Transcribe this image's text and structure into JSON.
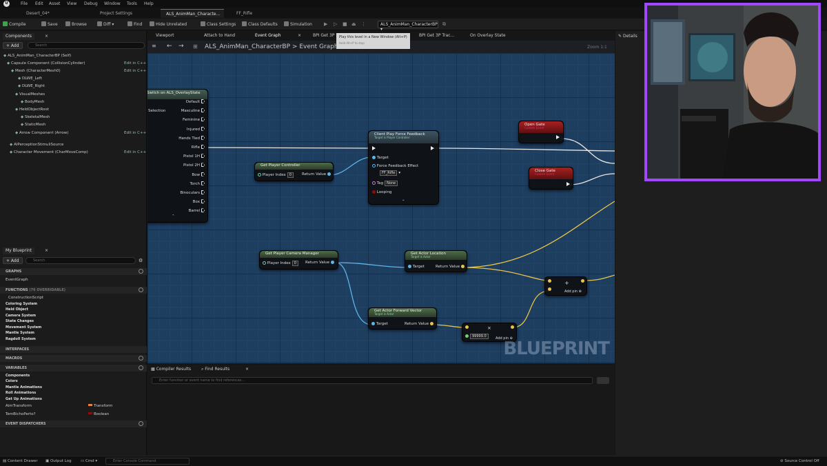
{
  "menu": [
    "File",
    "Edit",
    "Asset",
    "View",
    "Debug",
    "Window",
    "Tools",
    "Help"
  ],
  "logo": "U",
  "doc_tabs": [
    "Desert_04*",
    "Project Settings",
    "ALS_AnimMan_Characte...",
    "FF_Rifle"
  ],
  "toolbar": {
    "compile": "Compile",
    "save": "Save",
    "browse": "Browse",
    "diff": "Diff",
    "find": "Find",
    "hide_unrelated": "Hide Unrelated",
    "class_settings": "Class Settings",
    "class_defaults": "Class Defaults",
    "simulation": "Simulation",
    "debug_object": "ALS_AnimMan_CharacterBP"
  },
  "tooltip": {
    "title": "Play this level in a New Window (Alt+P)",
    "hint": "Hold Alt+P to stop"
  },
  "components": {
    "tab": "Components",
    "add": "+ Add",
    "search_placeholder": "Search",
    "items": [
      {
        "label": "ALS_AnimMan_CharacterBP (Self)",
        "edit": ""
      },
      {
        "label": "Capsule Component (CollisionCylinder)",
        "edit": "Edit in C++"
      },
      {
        "label": "Mesh (CharacterMesh0)",
        "edit": "Edit in C++"
      },
      {
        "label": "DLWE_Left",
        "edit": ""
      },
      {
        "label": "DLWE_Right",
        "edit": ""
      },
      {
        "label": "VisualMeshes",
        "edit": ""
      },
      {
        "label": "BodyMesh",
        "edit": ""
      },
      {
        "label": "HeldObjectRoot",
        "edit": ""
      },
      {
        "label": "SkeletalMesh",
        "edit": ""
      },
      {
        "label": "StaticMesh",
        "edit": ""
      },
      {
        "label": "Arrow Component (Arrow)",
        "edit": "Edit in C++"
      },
      {
        "label": "AIPerceptionStimuliSource",
        "edit": ""
      },
      {
        "label": "Character Movement (CharMoveComp)",
        "edit": "Edit in C++"
      }
    ]
  },
  "my_blueprint": {
    "tab": "My Blueprint",
    "add": "+ Add",
    "search_placeholder": "Search",
    "graphs_header": "GRAPHS",
    "event_graph": "EventGraph",
    "functions_header": "FUNCTIONS",
    "functions_count": "(76 OVERRIDABLE)",
    "function_items": [
      "ConstructionScript",
      "Coloring System",
      "Held Object",
      "Camera System",
      "State Changes",
      "Movement System",
      "Mantle System",
      "Ragdoll System"
    ],
    "interfaces_header": "INTERFACES",
    "macros_header": "MACROS",
    "variables_header": "VARIABLES",
    "variable_cats": [
      "Components",
      "Colors",
      "Mantle Animations",
      "Roll Animations",
      "Get Up Animations"
    ],
    "variables": [
      {
        "name": "AimTransform",
        "type": "Transform"
      },
      {
        "name": "TemBichoPerto?",
        "type": "Boolean"
      }
    ],
    "event_dispatchers_header": "EVENT DISPATCHERS"
  },
  "graph_tabs": [
    "Viewport",
    "Attach to Hand",
    "Event Graph",
    "BPI Get 3P",
    "BPI Get 3P Trac...",
    "On Overlay State"
  ],
  "breadcrumb": {
    "blueprint": "ALS_AnimMan_CharacterBP",
    "sep": ">",
    "graph": "Event Graph"
  },
  "zoom": "Zoom 1:1",
  "nodes": {
    "switch": {
      "title": "Switch on ALS_OverlayState",
      "selection": "Selection",
      "outputs": [
        "Default",
        "Masculine",
        "Feminine",
        "Injured",
        "Hands Tied",
        "Rifle",
        "Pistol 1H",
        "Pistol 2H",
        "Bow",
        "Torch",
        "Binoculars",
        "Box",
        "Barrel"
      ]
    },
    "get_player_controller": {
      "title": "Get Player Controller",
      "in": "Player Index",
      "in_val": "0",
      "out": "Return Value"
    },
    "client_play_ff": {
      "title": "Client Play Force Feedback",
      "subtitle": "Target is Player Controller",
      "target": "Target",
      "effect": "Force Feedback Effect",
      "effect_val": "FF_Rifle",
      "tag": "Tag",
      "tag_val": "None",
      "looping": "Looping"
    },
    "open_gate": {
      "title": "Open Gate",
      "subtitle": "Custom Event"
    },
    "close_gate": {
      "title": "Close Gate",
      "subtitle": "Custom Event"
    },
    "get_camera_manager": {
      "title": "Get Player Camera Manager",
      "in": "Player Index",
      "in_val": "0",
      "out": "Return Value"
    },
    "get_actor_location": {
      "title": "Get Actor Location",
      "subtitle": "Target is Actor",
      "target": "Target",
      "out": "Return Value"
    },
    "add_node": {
      "label": "Add pin"
    },
    "get_forward": {
      "title": "Get Actor Forward Vector",
      "subtitle": "Target is Actor",
      "target": "Target",
      "out": "Return Value"
    },
    "multiply": {
      "value": "99999.0",
      "label": "Add pin"
    }
  },
  "watermark": "BLUEPRINT",
  "bottom": {
    "tab1": "Compiler Results",
    "tab2": "Find Results",
    "search_placeholder": "Enter function or event name to find references..."
  },
  "details_tab": "Details",
  "status": {
    "content_drawer": "Content Drawer",
    "output_log": "Output Log",
    "cmd": "Cmd",
    "console_placeholder": "Enter Console Command",
    "source_control": "Source Control Off"
  },
  "colors": {
    "accent": "#2f7ad6",
    "webcam_border": "#a047ff",
    "graph_bg": "#1e3e60",
    "exec_wire": "#e6e6e6",
    "vector_wire": "#e8c44a",
    "object_wire": "#5fb6e8",
    "event_header": "#9c1c1c",
    "pure_header": "#3d5a3a",
    "call_header": "#3b4f5e"
  }
}
